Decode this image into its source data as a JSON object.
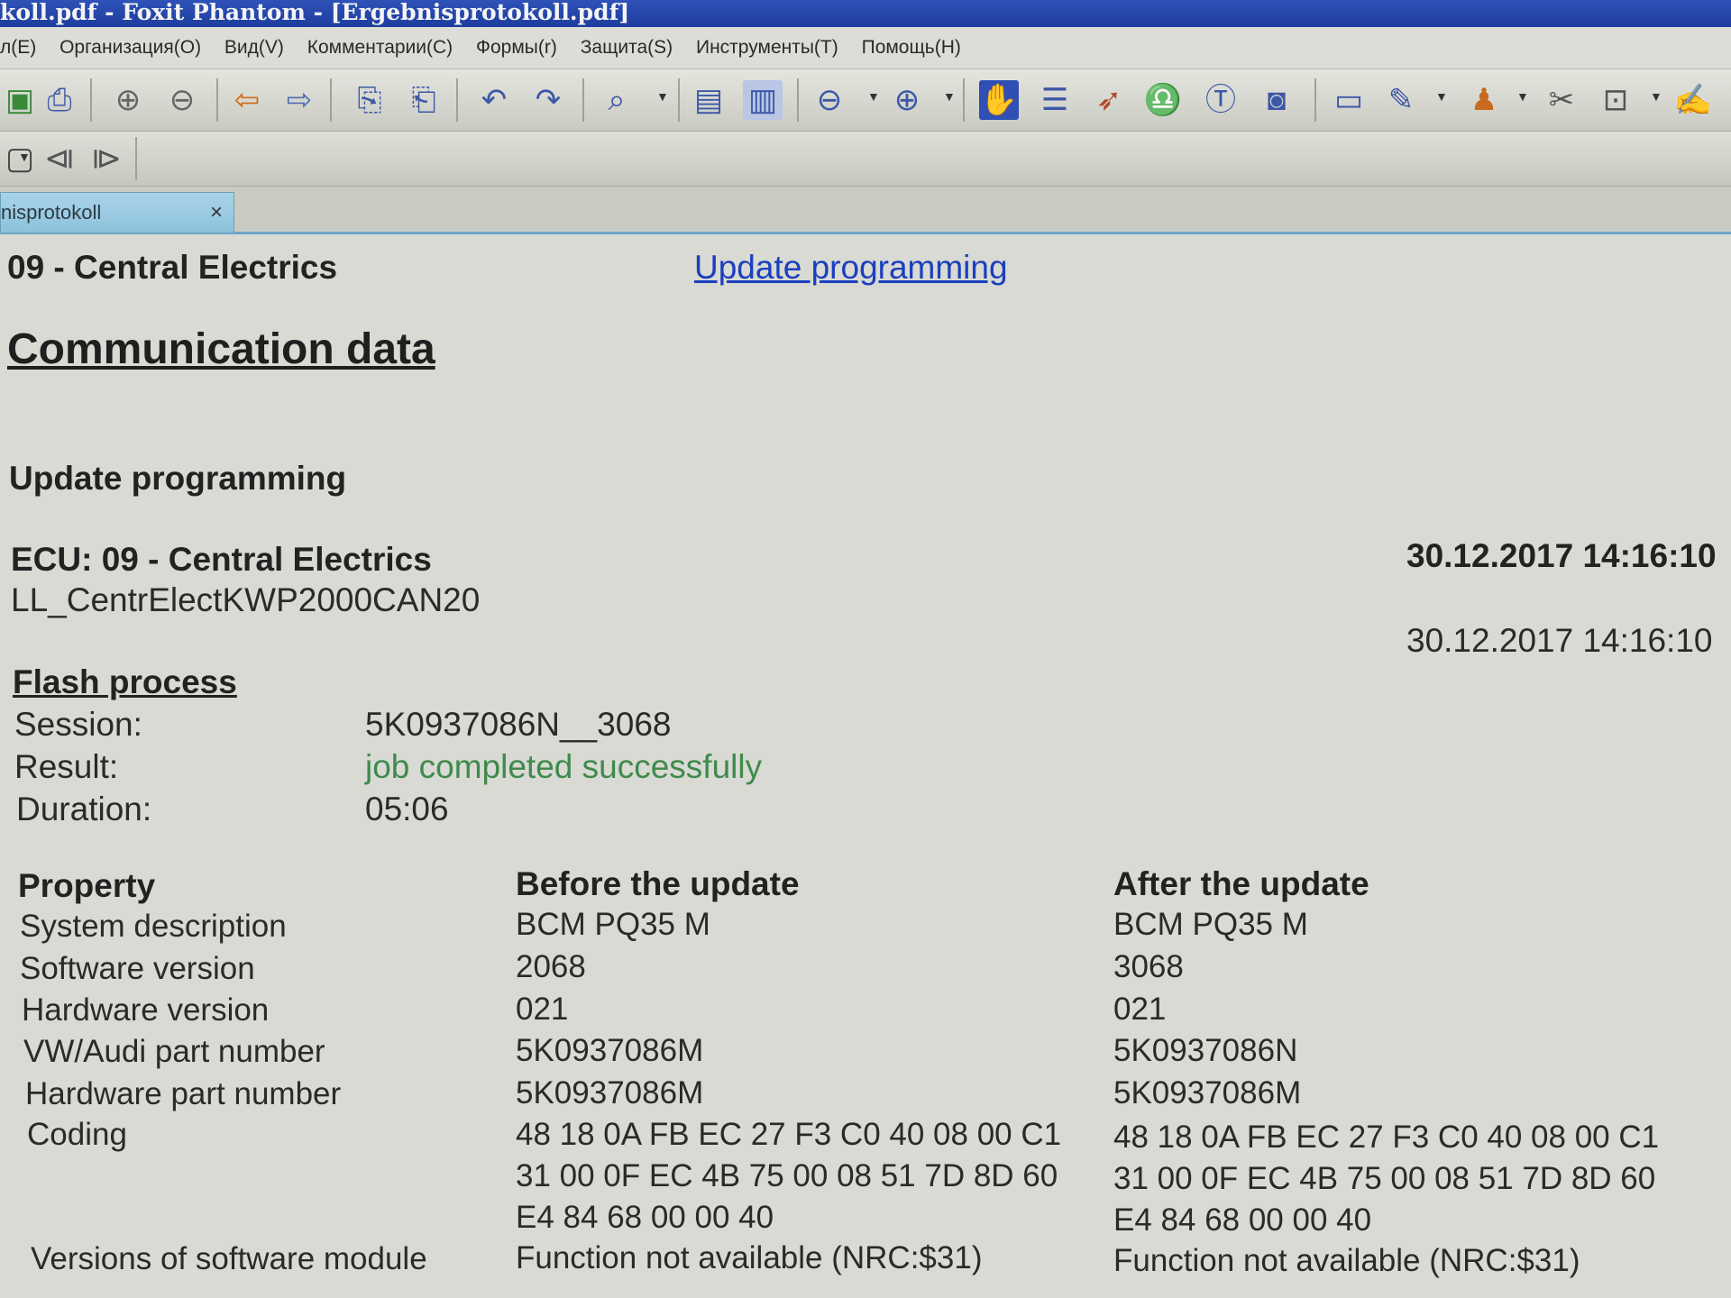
{
  "window": {
    "title": "koll.pdf - Foxit Phantom - [Ergebnisprotokoll.pdf]"
  },
  "menu": [
    "л(E)",
    "Организация(O)",
    "Вид(V)",
    "Комментарии(C)",
    "Формы(r)",
    "Защита(S)",
    "Инструменты(T)",
    "Помощь(H)"
  ],
  "tab": {
    "title": "nisprotokoll",
    "close": "×"
  },
  "header": {
    "module": "09 - Central Electrics",
    "link": "Update programming"
  },
  "section_title": "Communication data",
  "subsection_title": "Update programming",
  "ecu": {
    "title": "ECU: 09 - Central Electrics",
    "datetime_bold": "30.12.2017 14:16:10",
    "name": "LL_CentrElectKWP2000CAN20",
    "datetime": "30.12.2017 14:16:10"
  },
  "flash": {
    "title": "Flash process",
    "session_label": "Session:",
    "session_value": "5K0937086N__3068",
    "result_label": "Result:",
    "result_value": "job completed successfully",
    "duration_label": "Duration:",
    "duration_value": "05:06"
  },
  "table": {
    "headers": [
      "Property",
      "Before the update",
      "After the update"
    ],
    "rows": [
      [
        "System description",
        "BCM PQ35 M",
        "BCM PQ35 M"
      ],
      [
        "Software version",
        "2068",
        "3068"
      ],
      [
        "Hardware version",
        "021",
        "021"
      ],
      [
        "VW/Audi part number",
        "5K0937086M",
        "5K0937086N"
      ],
      [
        "Hardware part number",
        "5K0937086M",
        "5K0937086M"
      ]
    ],
    "coding_label": "Coding",
    "coding_before": [
      "48 18 0A FB EC 27 F3 C0 40 08 00 C1",
      "31 00 0F EC 4B 75 00 08 51 7D 8D 60",
      "E4 84 68 00 00 40"
    ],
    "coding_after": [
      "48 18 0A FB EC 27 F3 C0 40 08 00 C1",
      "31 00 0F EC 4B 75 00 08 51 7D 8D 60",
      "E4 84 68 00 00 40"
    ],
    "versions_label": "Versions of software module",
    "versions_before": "Function not available (NRC:$31)",
    "versions_after": "Function not available (NRC:$31)"
  },
  "colors": {
    "link": "#1b3fbf",
    "success": "#3f8a4c",
    "titlebar": "#2f52b8"
  },
  "icons": {
    "toolbar1": [
      "save-check-icon",
      "print-icon",
      "prev-page-icon",
      "next-page-icon",
      "back-icon",
      "forward-icon",
      "extract-pages-icon",
      "insert-pages-icon",
      "undo-icon",
      "redo-icon",
      "zoom-icon",
      "fit-page-icon",
      "fit-width-icon",
      "zoom-out-icon",
      "zoom-in-icon",
      "hand-icon",
      "select-text-icon",
      "select-arrow-icon",
      "find-icon",
      "typewriter-icon",
      "snapshot-icon",
      "view-icon",
      "edit-icon",
      "stamp-icon",
      "attach-icon",
      "lock-icon",
      "sign-icon"
    ],
    "toolbar2": [
      "box-icon",
      "page-first-icon",
      "page-last-icon"
    ]
  }
}
